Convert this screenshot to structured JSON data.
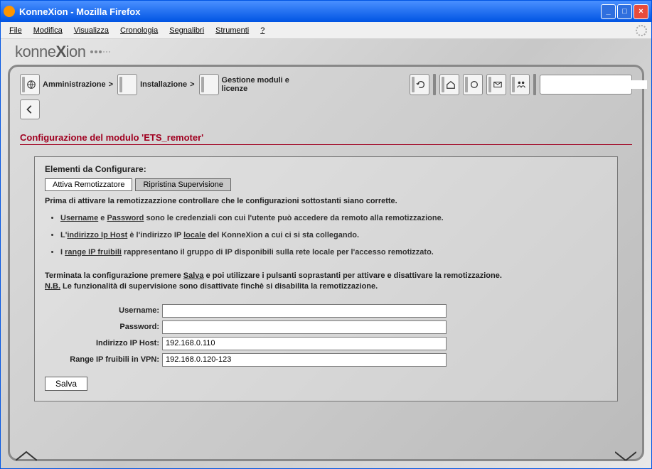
{
  "window": {
    "title": "KonneXion - Mozilla Firefox"
  },
  "menu": {
    "file": "File",
    "edit": "Modifica",
    "view": "Visualizza",
    "history": "Cronologia",
    "bookmarks": "Segnalibri",
    "tools": "Strumenti",
    "help": "?"
  },
  "brand": {
    "prefix": "konne",
    "bold": "X",
    "suffix": "ion"
  },
  "breadcrumb": {
    "admin": "Amministrazione",
    "install": "Installazione",
    "modules": "Gestione moduli e licenze",
    "sep": ">"
  },
  "heading": "Configurazione del modulo 'ETS_remoter'",
  "box": {
    "title": "Elementi da Configurare:",
    "tab1": "Attiva Remotizzatore",
    "tab2": "Ripristina Supervisione",
    "intro": "Prima di attivare la remotizzazzione controllare che le configurazioni sottostanti siano corrette.",
    "bullet1_a": "Username",
    "bullet1_b": "Password",
    "bullet1_txt": " sono le credenziali con cui l'utente può accedere da remoto alla remotizzazione.",
    "bullet1_e": " e ",
    "bullet2_a": "indirizzo Ip Host",
    "bullet2_b": "locale",
    "bullet2_pre": "L'",
    "bullet2_mid": " è l'indirizzo IP ",
    "bullet2_post": " del KonneXion a cui ci si sta collegando.",
    "bullet3_a": "range IP fruibili",
    "bullet3_pre": "I ",
    "bullet3_post": " rappresentano il gruppo di IP disponibili sulla rete locale per l'accesso remotizzato.",
    "note1a": "Terminata la configurazione premere ",
    "note1_salva": "Salva",
    "note1b": " e poi utilizzare i pulsanti soprastanti per attivare e disattivare la remotizzazione.",
    "note2a": "N.B.",
    "note2b": " Le funzionalità di supervisione sono disattivate finchè si disabilita la remotizzazione."
  },
  "form": {
    "username_label": "Username:",
    "username_value": "",
    "password_label": "Password:",
    "password_value": "",
    "iphost_label": "Indirizzo IP Host:",
    "iphost_value": "192.168.0.110",
    "range_label": "Range IP fruibili in VPN:",
    "range_value": "192.168.0.120-123",
    "save": "Salva"
  },
  "search": {
    "placeholder": ""
  }
}
